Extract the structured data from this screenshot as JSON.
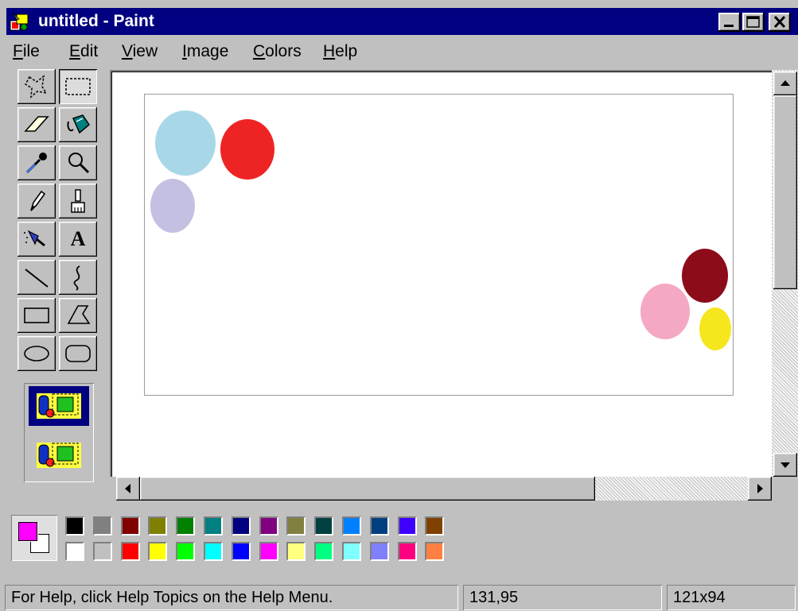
{
  "window": {
    "title": "untitled - Paint"
  },
  "menu": {
    "items": [
      {
        "mnemonic": "F",
        "rest": "ile"
      },
      {
        "mnemonic": "E",
        "rest": "dit"
      },
      {
        "mnemonic": "V",
        "rest": "iew"
      },
      {
        "mnemonic": "I",
        "rest": "mage"
      },
      {
        "mnemonic": "C",
        "rest": "olors"
      },
      {
        "mnemonic": "H",
        "rest": "elp"
      }
    ]
  },
  "tools": [
    {
      "icon": "free-form-select-icon"
    },
    {
      "icon": "rectangle-select-icon"
    },
    {
      "icon": "eraser-icon"
    },
    {
      "icon": "fill-bucket-icon"
    },
    {
      "icon": "color-picker-icon"
    },
    {
      "icon": "magnifier-icon"
    },
    {
      "icon": "pencil-icon"
    },
    {
      "icon": "brush-icon"
    },
    {
      "icon": "airbrush-icon"
    },
    {
      "icon": "text-icon",
      "glyph": "A"
    },
    {
      "icon": "line-icon"
    },
    {
      "icon": "curve-icon"
    },
    {
      "icon": "rectangle-icon"
    },
    {
      "icon": "polygon-icon"
    },
    {
      "icon": "ellipse-icon"
    },
    {
      "icon": "rounded-rectangle-icon"
    }
  ],
  "canvas": {
    "shapes": [
      {
        "color": "#a8d8e8"
      },
      {
        "color": "#ee2424"
      },
      {
        "color": "#c4c0e2"
      },
      {
        "color": "#8c0c1a"
      },
      {
        "color": "#f4a8c4"
      },
      {
        "color": "#f6e61e"
      }
    ]
  },
  "colors": {
    "foreground": "#ff00ff",
    "background": "#ffffff",
    "palette_top": [
      "#000000",
      "#808080",
      "#800000",
      "#808000",
      "#008000",
      "#008080",
      "#000080",
      "#800080",
      "#808040",
      "#004040",
      "#0080ff",
      "#004080",
      "#4000ff",
      "#804000"
    ],
    "palette_bottom": [
      "#ffffff",
      "#c0c0c0",
      "#ff0000",
      "#ffff00",
      "#00ff00",
      "#00ffff",
      "#0000ff",
      "#ff00ff",
      "#ffff80",
      "#00ff80",
      "#80ffff",
      "#8080ff",
      "#ff0080",
      "#ff8040"
    ]
  },
  "status": {
    "help_text": "For Help, click Help Topics on the Help Menu.",
    "coordinates": "131,95",
    "size": "121x94"
  }
}
